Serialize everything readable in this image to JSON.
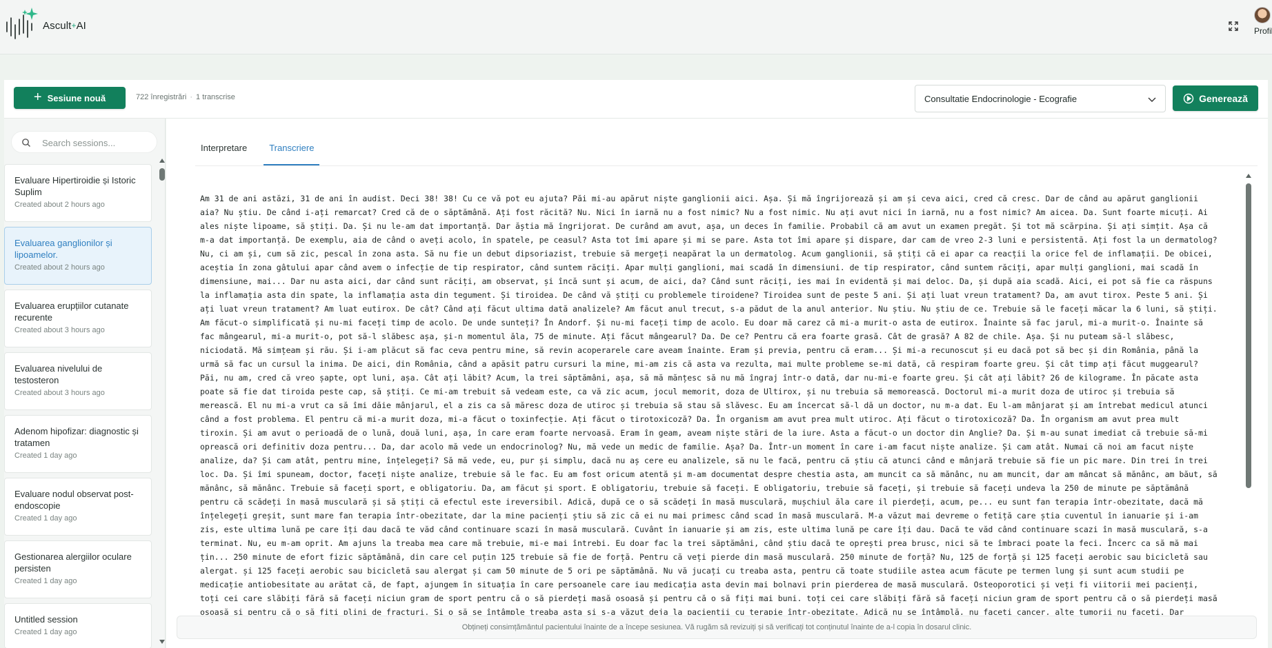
{
  "app": {
    "name": "Ascult",
    "name_suffix": "AI",
    "profile_label": "Profil"
  },
  "toolbar": {
    "new_session_label": "Sesiune nouă",
    "recordings_count": "722 înregistrări",
    "transcripts_count": "1 transcrise",
    "template_selected": "Consultatie Endocrinologie - Ecografie",
    "generate_label": "Generează"
  },
  "sidebar": {
    "search_placeholder": "Search sessions...",
    "sessions": [
      {
        "title": "Evaluare Hipertiroidie și Istoric Suplim",
        "created": "Created about 2 hours ago"
      },
      {
        "title": "Evaluarea ganglionilor și lipoamelor.",
        "created": "Created about 2 hours ago"
      },
      {
        "title": "Evaluarea erupțiilor cutanate recurente",
        "created": "Created about 3 hours ago"
      },
      {
        "title": "Evaluarea nivelului de testosteron",
        "created": "Created about 3 hours ago"
      },
      {
        "title": "Adenom hipofizar: diagnostic și tratamen",
        "created": "Created 1 day ago"
      },
      {
        "title": "Evaluare nodul observat post-endoscopie",
        "created": "Created 1 day ago"
      },
      {
        "title": "Gestionarea alergiilor oculare persisten",
        "created": "Created 1 day ago"
      },
      {
        "title": "Untitled session",
        "created": "Created 1 day ago"
      }
    ]
  },
  "main": {
    "tabs": [
      {
        "label": "Interpretare"
      },
      {
        "label": "Transcriere"
      }
    ],
    "transcript": "Am 31 de ani astăzi, 31 de ani în audist. Deci 38! 38! Cu ce vă pot eu ajuta? Păi mi-au apărut niște ganglionii aici. Așa. Și mă îngrijorează și am și ceva aici, cred că cresc. Dar de când au apărut ganglionii aia? Nu știu. De când i-ați remarcat? Cred că de o săptămână. Ați fost răcită? Nu. Nici în iarnă nu a fost nimic? Nu a fost nimic. Nu ați avut nici în iarnă, nu a fost nimic? Am aicea. Da. Sunt foarte micuți. Ai ales niște lipoame, să știți. Da. Și nu le-am dat importanță. Dar ăștia mă îngrijorat. De curând am avut, așa, un deces în familie. Probabil că am avut un examen pregăt. Și tot mă scărpina. Și ați simțit. Așa că m-a dat importanță. De exemplu, aia de când o aveți acolo, în spatele, pe ceasul? Asta tot îmi apare și mi se pare. Asta tot îmi apare și dispare, dar cam de vreo 2-3 luni e persistentă. Ați fost la un dermatolog? Nu, ci am și, cum să zic, pescal în zona asta. Să nu fie un debut dipsoriazist, trebuie să mergeți neapărat la un dermatolog. Acum ganglionii, să știți că ei apar ca reacții la orice fel de inflamații. De obicei, aceștia în zona gâtului apar când avem o infecție de tip respirator, când suntem răciți. Apar mulți ganglioni, mai scadă în dimensiuni. de tip respirator, când suntem răciți, apar mulți ganglioni, mai scadă în dimensiune, mai... Dar nu asta aici, dar când sunt răciți, am observat, și încă sunt și acum, de aici, da? Când sunt răciți, ies mai în evidentă și mai deloc. Da, și după aia scadă. Aici, ei pot să fie ca răspuns la inflamația asta din spate, la inflamația asta din tegument. Și tiroidea. De când vă știți cu problemele tiroidene? Tiroidea sunt de peste 5 ani. Și ați luat vreun tratament? Da, am avut tirox. Peste 5 ani. Și ați luat vreun tratament? Am luat eutirox. De cât? Când ați făcut ultima dată analizele? Am făcut anul trecut, s-a pădut de la anul anterior. Nu știu. Nu știu de ce. Trebuie să le faceți măcar la 6 luni, să știți. Am făcut-o simplificată și nu-mi faceți timp de acolo. De unde sunteți? În Andorf. Și nu-mi faceți timp de acolo. Eu doar mă carez că mi-a murit-o asta de eutirox. Înainte să fac jarul, mi-a murit-o. Înainte să fac mângearul, mi-a murit-o, pot să-l slăbesc așa, și-n momentul ăla, 75 de minute. Ați făcut mângearul? Da. De ce? Pentru că era foarte grasă. Cât de grasă? A 82 de chile. Așa. Și nu puteam să-l slăbesc, niciodată. Mă simțeam și rău. Și i-am plăcut să fac ceva pentru mine, să revin acoperarele care aveam înainte. Eram și previa, pentru că eram... Și mi-a recunoscut și eu dacă pot să bec și din România, până la urmă să fac un cursul la inima. De aici, din România, când a apăsit patru cursuri la mine, mi-am zis că asta va rezulta, mai multe probleme se-mi dată, că respiram foarte greu. Și cât timp ați făcut muggearul? Păi, nu am, cred că vreo șapte, opt luni, așa. Cât ați lăbit? Acum, la trei săptămâni, așa, să mă mănțesc să nu mă îngraj într-o dată, dar nu-mi-e foarte greu. Și cât ați lăbit? 26 de kilograme. În păcate asta poate să fie dat tiroida peste cap, să știți. Ce mi-am trebuit să vedeam este, ca vă zic acum, jocul memorit, doza de Ultirox, și nu trebuia să memorească. Doctorul mi-a murit doza de utiroc și trebuia să merească. El nu mi-a vrut ca să îmi dăie mânjarul, el a zis ca să măresc doza de utiroc și trebuia să stau să slăvesc. Eu am încercat să-l dă un doctor, nu m-a dat. Eu l-am mânjarat și am întrebat medicul atunci când a fost problema. El pentru că mi-a murit doza, mi-a făcut o toxinfecție. Ați făcut o tirotoxicoză? Da. În organism am avut prea mult utiroc. Ați făcut o tirotoxicoză? Da. În organism am avut prea mult tiroxin. Și am avut o perioadă de o lună, două luni, așa, în care eram foarte nervoasă. Eram în geam, aveam niște stări de la iure. Asta a făcut-o un doctor din Anglie? Da. Și m-au sunat imediat că trebuie să-mi oprească ori definitiv doza pentru... Da, dar acolo mă vede un endocrinolog? Nu, mă vede un medic de familie. Așa? Da. Într-un moment în care i-am facut niște analize. Și cam atât. Numai că noi am facut niște analize, da? Și cam atât, pentru mine, înțelegeți? Să mă vede, eu, pur și simplu, dacă nu aș cere eu analizele, să nu le facă, pentru că știu că atunci când e mânjară trebuie să fie un pic mare. Din trei în trei loc. Da. Și îmi spuneam, doctor, faceți niște analize, trebuie să le fac. Eu am fost oricum atentă și m-am documentat despre chestia asta, am muncit ca să mănânc, nu am muncit, dar am mâncat să mănânc, am băut, să mănânc, să mănânc. Trebuie să faceți sport, e obligatoriu. Da, am făcut și sport. E obligatoriu, trebuie să faceți. E obligatoriu, trebuie să faceți, și trebuie să faceți undeva la 250 de minute pe săptămână pentru că scădeți în masă musculară și să știți că efectul este ireversibil. Adică, după ce o să scădeți în masă musculară, mușchiul ăla care il pierdeți, acum, pe... eu sunt fan terapia într-obezitate, dacă mă înțelegeți greșit, sunt mare fan terapia într-obezitate, dar la mine pacienți știu să zic că ei nu mai primesc când scad în masă musculară. M-a văzut mai devreme o fetiță care știa cuventul în ianuarie și i-am zis, este ultima lună pe care îți dau dacă te văd când continuare scazi în masă musculară. Cuvânt în ianuarie și am zis, este ultima lună pe care îți dau. Dacă te văd când continuare scazi în masă musculară, s-a terminat. Nu, eu m-am oprit. Am ajuns la treaba mea care mă trebuie, mi-e mai întrebi. Eu doar fac la trei săptămâni, când știu dacă te oprești prea brusc, nici să te îmbraci poate la feci. Încerc ca să mă mai țin... 250 minute de efort fizic săptămână, din care cel puțin 125 trebuie să fie de forță. Pentru că veți pierde din masă musculară. 250 minute de forță? Nu, 125 de forță și 125 faceți aerobic sau bicicletă sau alergat. și 125 faceți aerobic sau bicicletă sau alergat și cam 50 minute de 5 ori pe săptămână. Nu vă jucați cu treaba asta, pentru că toate studiile astea acum făcute pe termen lung și sunt acum studii pe medicație antiobesitate au arătat că, de fapt, ajungem în situația în care persoanele care iau medicația asta devin mai bolnavi prin pierderea de masă musculară. Osteoporotici și veți fi viitorii mei pacienți, toți cei care slăbiți fără să faceți niciun gram de sport pentru că o să pierdeți masă osoasă și pentru că o să fiți mai buni. toți cei care slăbiți fără să faceți niciun gram de sport pentru că o să pierdeți masă osoasă și pentru că o să fiți plini de fracturi. Și o să se întâmple treaba asta și s-a văzut deja la pacienții cu terapie într-obezitate. Adică nu se întâmplă, nu faceți cancer, alte tumorii nu faceți. Dar",
    "notice": "Obțineți consimțământul pacientului înainte de a începe sesiunea. Vă rugăm să revizuiți și să verificați tot conținutul înainte de a-l copia în dosarul clinic."
  },
  "icons": {
    "logo": "waveform-sparkle-logo",
    "expand": "expand-icon",
    "new_session": "plus-icon",
    "generate": "play-circle-icon",
    "dropdown": "chevron-down-icon",
    "search": "search-icon"
  },
  "colors": {
    "primary": "#12805c",
    "active_tab": "#2f7fc0",
    "active_session_bg": "#e8f3fb"
  }
}
